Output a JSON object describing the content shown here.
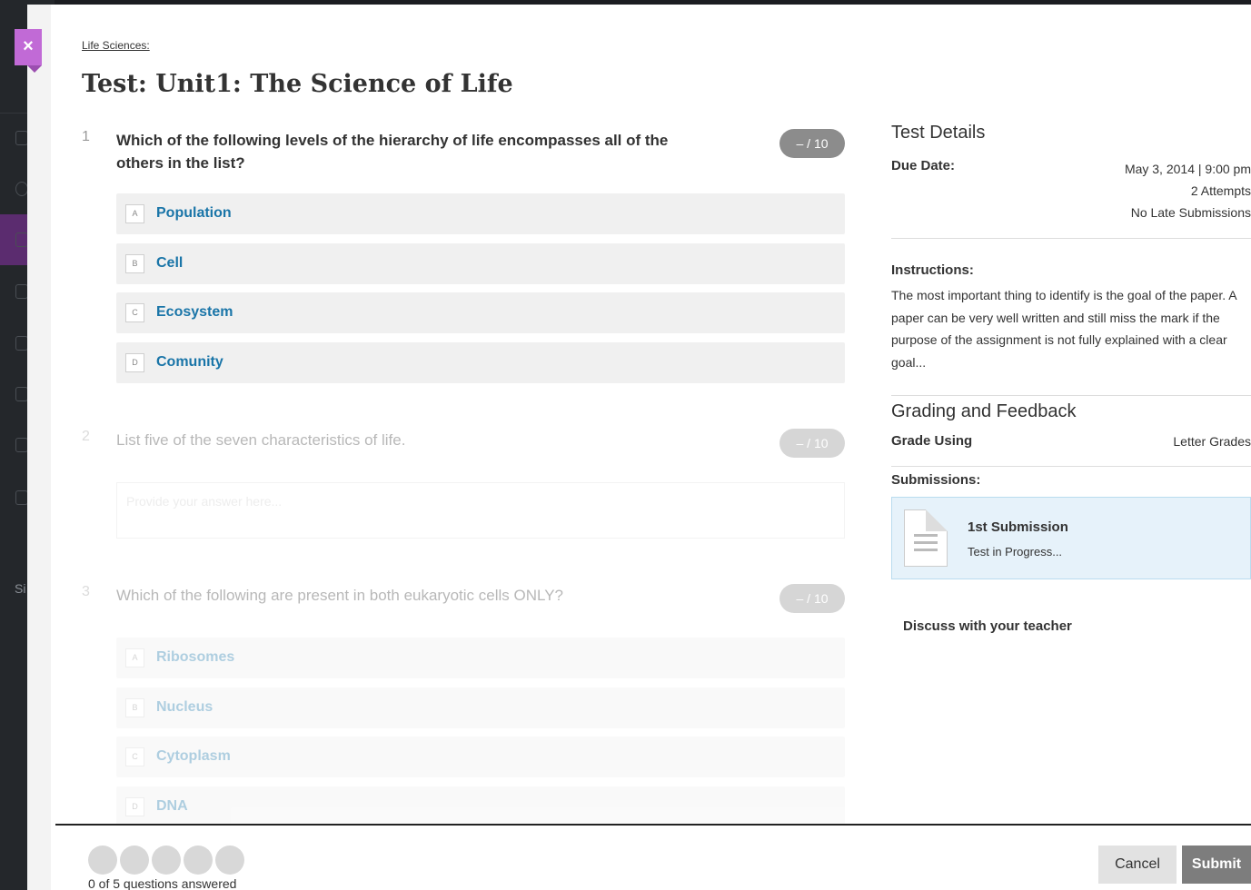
{
  "breadcrumb": "Life Sciences:",
  "page_title": "Test: Unit1: The Science of Life",
  "questions": [
    {
      "number": "1",
      "text": "Which of the following levels of the hierarchy of life encompasses all of the others in the list?",
      "score": "– / 10",
      "options": [
        {
          "letter": "A",
          "label": "Population"
        },
        {
          "letter": "B",
          "label": "Cell"
        },
        {
          "letter": "C",
          "label": "Ecosystem"
        },
        {
          "letter": "D",
          "label": "Comunity"
        }
      ]
    },
    {
      "number": "2",
      "text": "List five of the seven characteristics of life.",
      "score": "– / 10",
      "answer_placeholder": "Provide your answer here..."
    },
    {
      "number": "3",
      "text": "Which of the following are present in both eukaryotic cells ONLY?",
      "score": "– / 10",
      "options": [
        {
          "letter": "A",
          "label": "Ribosomes"
        },
        {
          "letter": "B",
          "label": "Nucleus"
        },
        {
          "letter": "C",
          "label": "Cytoplasm"
        },
        {
          "letter": "D",
          "label": "DNA"
        }
      ]
    }
  ],
  "details": {
    "heading": "Test Details",
    "due_label": "Due Date:",
    "due_date": "May 3, 2014 | 9:00 pm",
    "attempts": "2 Attempts",
    "late": "No Late Submissions",
    "instructions_label": "Instructions:",
    "instructions": "The most important thing to identify is the goal of the paper. A paper can be very well written and still miss the mark if the purpose of the assignment is not fully explained with a clear goal...",
    "grading_heading": "Grading and Feedback",
    "grade_using_label": "Grade Using",
    "grade_using_value": "Letter Grades",
    "submissions_label": "Submissions:",
    "submission_title": "1st Submission",
    "submission_status": "Test in Progress...",
    "discuss": "Discuss with your teacher"
  },
  "footer": {
    "answered": 0,
    "total": 5,
    "progress_label": "0 of 5 questions answered",
    "cancel": "Cancel",
    "submit": "Submit"
  },
  "close_icon": "×",
  "colors": {
    "accent": "#c16ad6",
    "link": "#1a75a8",
    "score_pill": "#8c8c8c"
  }
}
